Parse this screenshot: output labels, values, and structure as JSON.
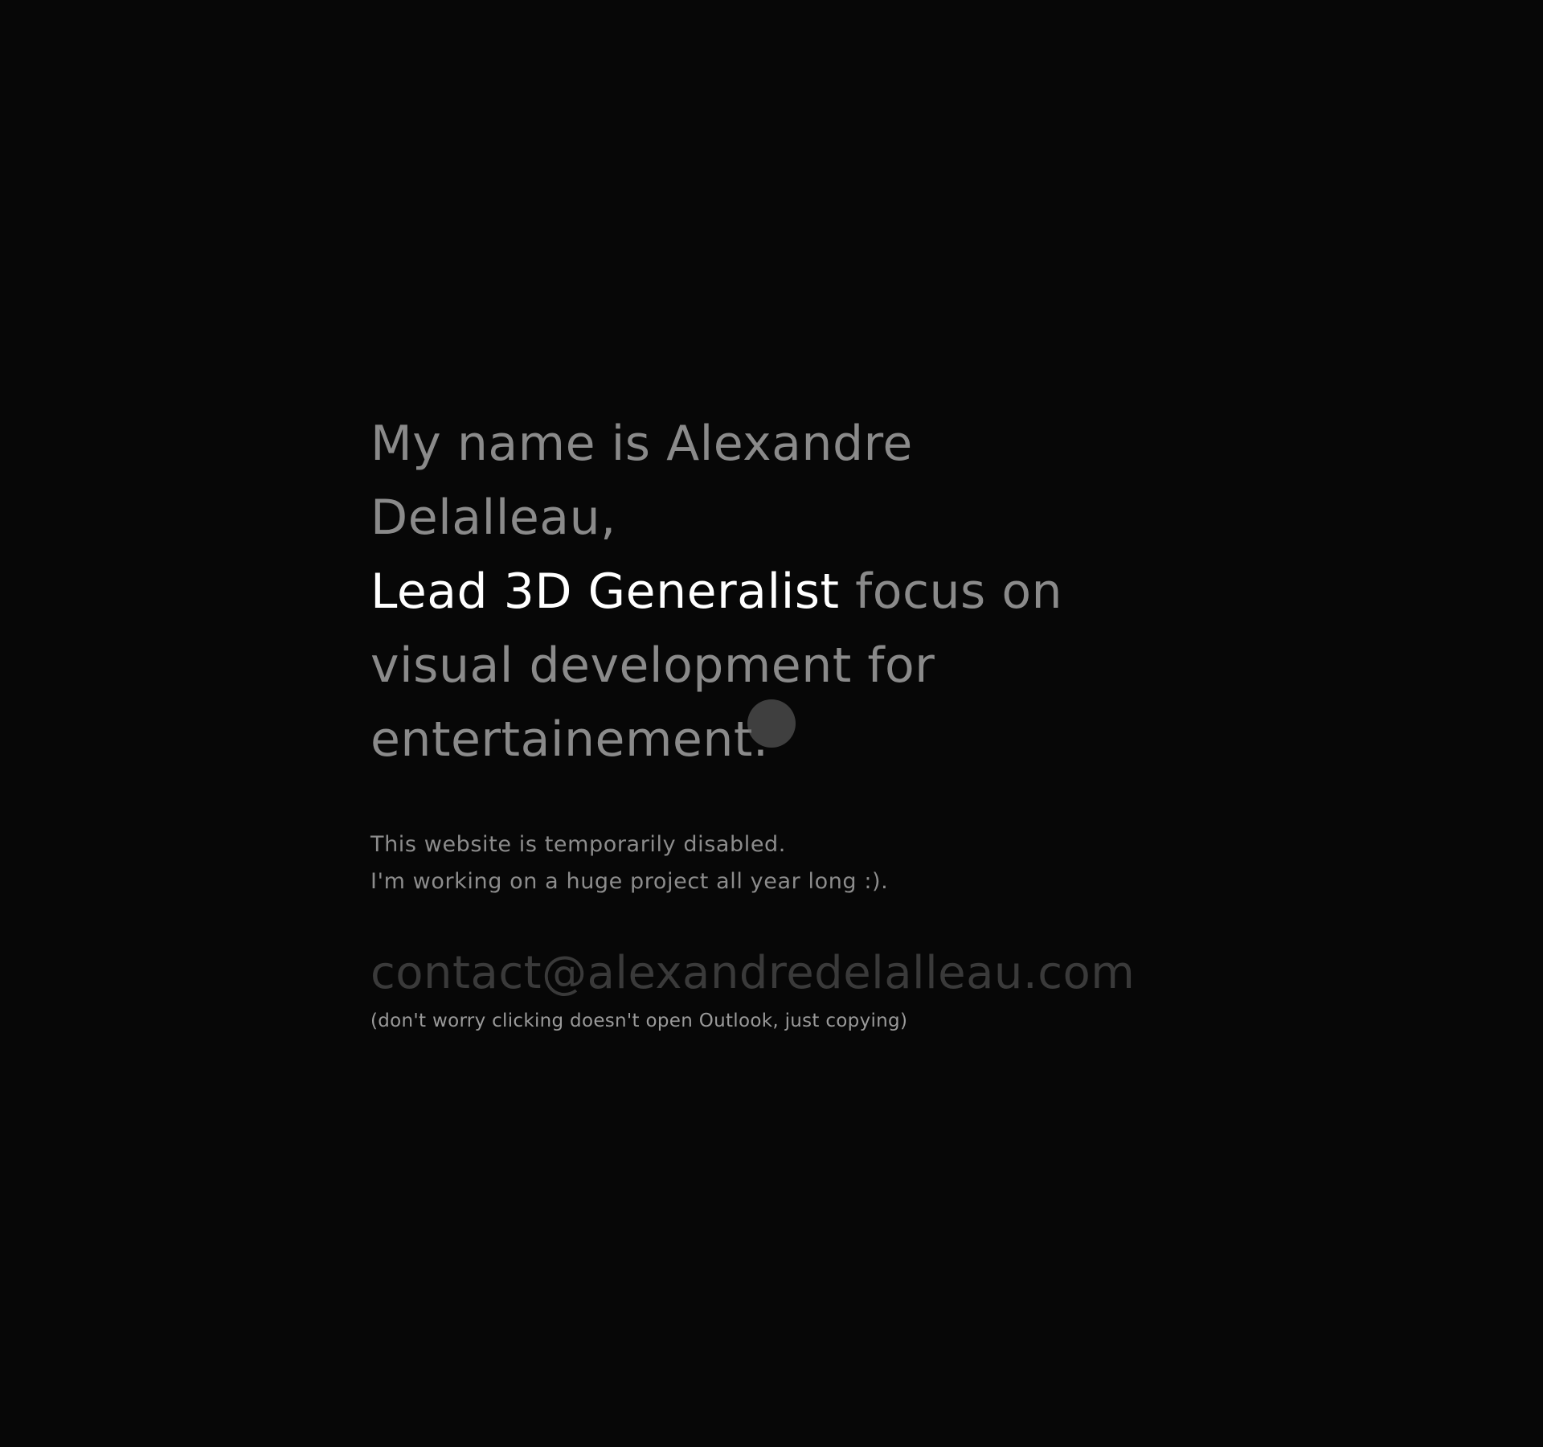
{
  "headline": {
    "intro": "My name is Alexandre Delalleau,",
    "role": "Lead 3D Generalist",
    "rest_first": " focus on",
    "rest_second": "visual development for entertainement."
  },
  "status": {
    "line1": "This website is temporarily disabled.",
    "line2": "I'm working on a huge project all year long :)."
  },
  "contact": {
    "email": "contact@alexandredelalleau.com",
    "note": "(don't worry clicking doesn't open Outlook, just copying)"
  },
  "colors": {
    "background": "#070707",
    "text_dim": "#8a8a8a",
    "text_highlight": "#ffffff",
    "email": "#3a3a3a"
  }
}
